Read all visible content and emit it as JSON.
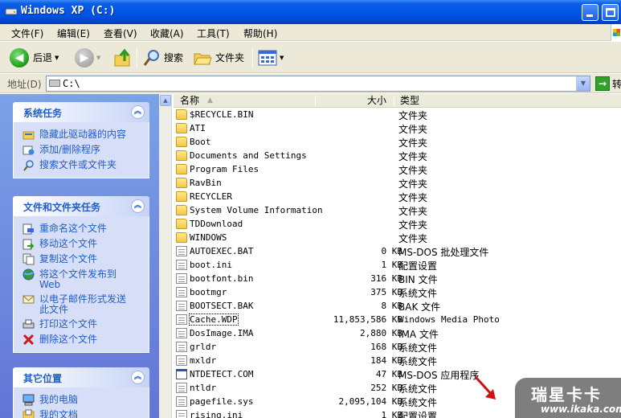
{
  "window": {
    "title": "Windows XP (C:)"
  },
  "menu": [
    "文件(F)",
    "编辑(E)",
    "查看(V)",
    "收藏(A)",
    "工具(T)",
    "帮助(H)"
  ],
  "toolbar": {
    "back_label": "后退",
    "search_label": "搜索",
    "folders_label": "文件夹"
  },
  "address": {
    "label": "地址(D)",
    "value": "C:\\",
    "go_label": "转"
  },
  "left_pane": {
    "system_tasks": {
      "title": "系统任务",
      "items": [
        "隐藏此驱动器的内容",
        "添加/删除程序",
        "搜索文件或文件夹"
      ]
    },
    "file_tasks": {
      "title": "文件和文件夹任务",
      "items": [
        "重命名这个文件",
        "移动这个文件",
        "复制这个文件",
        "将这个文件发布到 Web",
        "以电子邮件形式发送此文件",
        "打印这个文件",
        "删除这个文件"
      ]
    },
    "other_places": {
      "title": "其它位置",
      "items": [
        "我的电脑",
        "我的文档"
      ]
    }
  },
  "file_list": {
    "columns": {
      "name": "名称",
      "size": "大小",
      "type": "类型"
    },
    "rows": [
      {
        "name": "$RECYCLE.BIN",
        "size": "",
        "type": "文件夹",
        "icon": "folder"
      },
      {
        "name": "ATI",
        "size": "",
        "type": "文件夹",
        "icon": "folder"
      },
      {
        "name": "Boot",
        "size": "",
        "type": "文件夹",
        "icon": "folder"
      },
      {
        "name": "Documents and Settings",
        "size": "",
        "type": "文件夹",
        "icon": "folder"
      },
      {
        "name": "Program Files",
        "size": "",
        "type": "文件夹",
        "icon": "folder"
      },
      {
        "name": "RavBin",
        "size": "",
        "type": "文件夹",
        "icon": "folder"
      },
      {
        "name": "RECYCLER",
        "size": "",
        "type": "文件夹",
        "icon": "folder"
      },
      {
        "name": "System Volume Information",
        "size": "",
        "type": "文件夹",
        "icon": "folder"
      },
      {
        "name": "TDDownload",
        "size": "",
        "type": "文件夹",
        "icon": "folder"
      },
      {
        "name": "WINDOWS",
        "size": "",
        "type": "文件夹",
        "icon": "folder"
      },
      {
        "name": "AUTOEXEC.BAT",
        "size": "0 KB",
        "type": "MS-DOS 批处理文件",
        "icon": "doc"
      },
      {
        "name": "boot.ini",
        "size": "1 KB",
        "type": "配置设置",
        "icon": "doc"
      },
      {
        "name": "bootfont.bin",
        "size": "316 KB",
        "type": "BIN 文件",
        "icon": "doc"
      },
      {
        "name": "bootmgr",
        "size": "375 KB",
        "type": "系统文件",
        "icon": "doc"
      },
      {
        "name": "BOOTSECT.BAK",
        "size": "8 KB",
        "type": "BAK 文件",
        "icon": "doc"
      },
      {
        "name": "Cache.WDP",
        "size": "11,853,586 KB",
        "type": "Windows Media Photo",
        "icon": "doc",
        "selected": true
      },
      {
        "name": "DosImage.IMA",
        "size": "2,880 KB",
        "type": "IMA 文件",
        "icon": "doc"
      },
      {
        "name": "grldr",
        "size": "168 KB",
        "type": "系统文件",
        "icon": "doc"
      },
      {
        "name": "mxldr",
        "size": "184 KB",
        "type": "系统文件",
        "icon": "doc"
      },
      {
        "name": "NTDETECT.COM",
        "size": "47 KB",
        "type": "MS-DOS 应用程序",
        "icon": "exe"
      },
      {
        "name": "ntldr",
        "size": "252 KB",
        "type": "系统文件",
        "icon": "doc"
      },
      {
        "name": "pagefile.sys",
        "size": "2,095,104 KB",
        "type": "系统文件",
        "icon": "doc"
      },
      {
        "name": "rising.ini",
        "size": "1 KB",
        "type": "配置设置",
        "icon": "doc"
      }
    ]
  },
  "watermark": {
    "main": "瑞星卡卡",
    "sub": "www.ikaka.com"
  },
  "colors": {
    "title_bar": "#0055e5",
    "task_pane": "#6b8ee0",
    "link_blue": "#215dc6",
    "annotation_arrow": "#d01010"
  }
}
